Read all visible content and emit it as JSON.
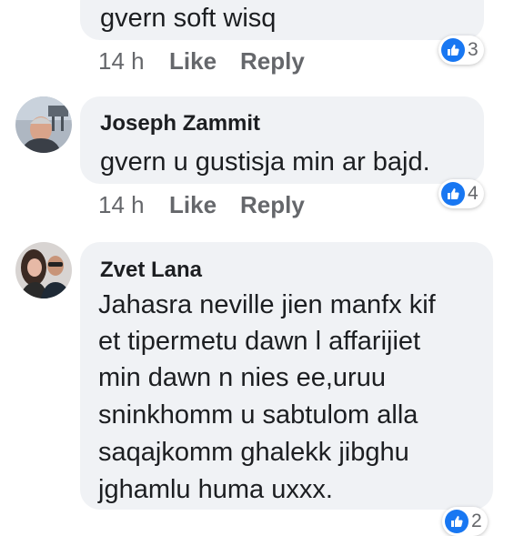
{
  "comments": [
    {
      "lines": [
        "gvern soft wisq"
      ],
      "time": "14 h",
      "like_label": "Like",
      "reply_label": "Reply",
      "reaction_count": "3"
    },
    {
      "author": "Joseph Zammit",
      "lines": [
        "gvern u gustisja min ar bajd."
      ],
      "time": "14 h",
      "like_label": "Like",
      "reply_label": "Reply",
      "reaction_count": "4",
      "avatar_icon": "profile-photo-icon"
    },
    {
      "author": "Zvet Lana",
      "lines": [
        "Jahasra neville jien manfx kif",
        "et tipermetu dawn l affarijiet",
        "min dawn n nies ee,uruu",
        "sninkhomm u sabtulom alla",
        "saqajkomm ghalekk jibghu",
        "jghamlu huma uxxx."
      ],
      "reaction_count": "2",
      "avatar_icon": "couple-photo-icon"
    }
  ],
  "colors": {
    "bubble": "#f0f2f5",
    "meta_text": "#65676b",
    "like_blue": "#1877f2"
  }
}
